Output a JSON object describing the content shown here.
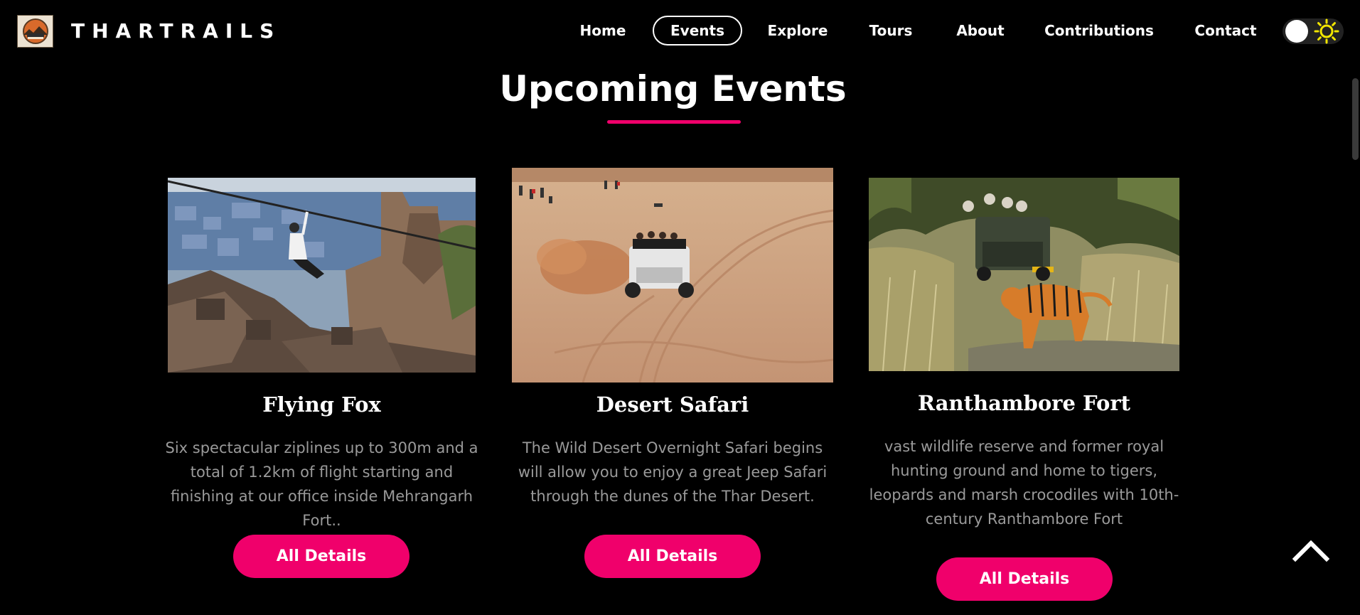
{
  "header": {
    "brand": "THARTRAILS",
    "logo_icon": "thartrails-logo-icon",
    "nav": [
      {
        "label": "Home"
      },
      {
        "label": "Events",
        "active": true
      },
      {
        "label": "Explore"
      },
      {
        "label": "Tours"
      },
      {
        "label": "About"
      },
      {
        "label": "Contributions"
      },
      {
        "label": "Contact"
      }
    ],
    "theme_toggle_icon": "sun-icon"
  },
  "main": {
    "title": "Upcoming Events",
    "accent_color": "#f0006b",
    "events": [
      {
        "title": "Flying Fox",
        "description": "Six spectacular ziplines up to 300m and a total of 1.2km of flight starting and finishing at our office inside Mehrangarh Fort..",
        "button_label": "All Details",
        "image_icon": "zipline-fort-photo"
      },
      {
        "title": "Desert Safari",
        "description": "The Wild Desert Overnight Safari begins will allow you to enjoy a great Jeep Safari through the dunes of the Thar Desert.",
        "button_label": "All Details",
        "image_icon": "desert-jeep-photo"
      },
      {
        "title": "Ranthambore Fort",
        "description": "vast wildlife reserve and former royal hunting ground and home to tigers, leopards and marsh crocodiles with 10th-century Ranthambore Fort",
        "button_label": "All Details",
        "image_icon": "tiger-safari-photo"
      }
    ]
  },
  "back_to_top_icon": "chevron-up-icon"
}
